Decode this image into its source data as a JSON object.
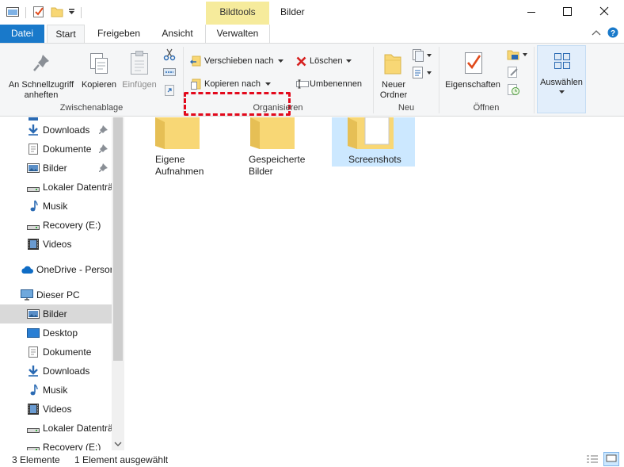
{
  "window": {
    "title": "Bilder",
    "contextual_tab_group": "Bildtools"
  },
  "tabs": {
    "datei": "Datei",
    "start": "Start",
    "freigeben": "Freigeben",
    "ansicht": "Ansicht",
    "verwalten": "Verwalten"
  },
  "ribbon": {
    "zwischenablage": {
      "label": "Zwischenablage",
      "pin_quick_access": "An Schnellzugriff anheften",
      "copy": "Kopieren",
      "paste": "Einfügen"
    },
    "organisieren": {
      "label": "Organisieren",
      "move_to": "Verschieben nach",
      "copy_to": "Kopieren nach",
      "delete": "Löschen",
      "rename": "Umbenennen"
    },
    "neu": {
      "label": "Neu",
      "new_folder": "Neuer Ordner"
    },
    "oeffnen": {
      "label": "Öffnen",
      "properties": "Eigenschaften"
    },
    "select": {
      "label": "Auswählen"
    }
  },
  "colors": {
    "accent": "#1979ca",
    "contextual": "#f6eb9c",
    "highlight_border": "#e3091c",
    "selection": "#cce8ff",
    "folder": "#f8d775"
  },
  "nav": {
    "items": [
      {
        "label": "Downloads",
        "icon": "download-arrow-icon",
        "pinned": true
      },
      {
        "label": "Dokumente",
        "icon": "document-icon",
        "pinned": true
      },
      {
        "label": "Bilder",
        "icon": "pictures-icon",
        "pinned": true
      },
      {
        "label": "Lokaler Datenträ",
        "icon": "drive-icon"
      },
      {
        "label": "Musik",
        "icon": "music-note-icon"
      },
      {
        "label": "Recovery (E:)",
        "icon": "drive-icon"
      },
      {
        "label": "Videos",
        "icon": "film-icon"
      },
      {
        "label": "OneDrive - Persor",
        "icon": "cloud-icon"
      },
      {
        "label": "Dieser PC",
        "icon": "computer-icon"
      },
      {
        "label": "Bilder",
        "icon": "pictures-icon",
        "selected": true
      },
      {
        "label": "Desktop",
        "icon": "desktop-icon"
      },
      {
        "label": "Dokumente",
        "icon": "document-icon"
      },
      {
        "label": "Downloads",
        "icon": "download-arrow-icon"
      },
      {
        "label": "Musik",
        "icon": "music-note-icon"
      },
      {
        "label": "Videos",
        "icon": "film-icon"
      },
      {
        "label": "Lokaler Datenträ",
        "icon": "drive-icon"
      },
      {
        "label": "Recovery (E:)",
        "icon": "drive-icon"
      }
    ]
  },
  "content": {
    "folders": [
      {
        "label": "Eigene Aufnahmen"
      },
      {
        "label": "Gespeicherte Bilder"
      },
      {
        "label": "Screenshots",
        "selected": true
      }
    ]
  },
  "status": {
    "item_count": "3 Elemente",
    "selection": "1 Element ausgewählt"
  }
}
